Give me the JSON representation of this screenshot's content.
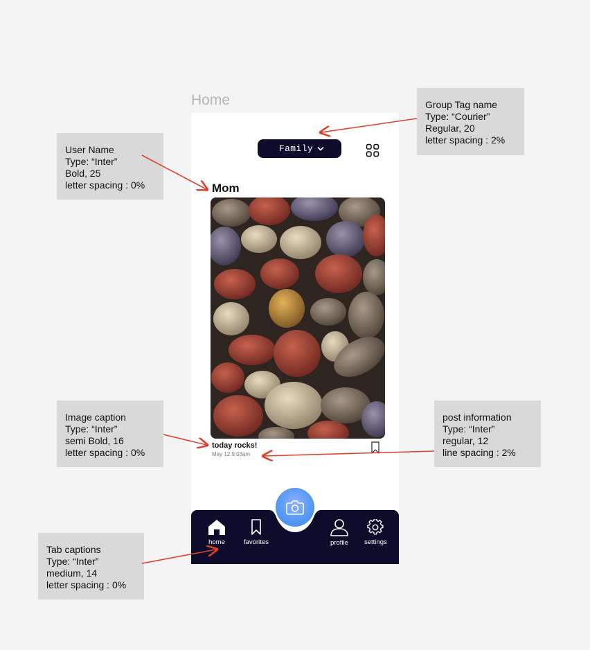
{
  "frame_title": "Home",
  "app": {
    "group_tag": "Family",
    "user_name": "Mom",
    "post": {
      "caption": "today rocks!",
      "info": "May 12 9:03am"
    },
    "tabs": [
      {
        "label": "home",
        "icon": "home-icon"
      },
      {
        "label": "favorites",
        "icon": "bookmark-icon"
      },
      {
        "label": "profile",
        "icon": "person-icon"
      },
      {
        "label": "settings",
        "icon": "gear-icon"
      }
    ],
    "colors": {
      "nav_bg": "#0d0d2b",
      "camera_button": "#5b9bf5",
      "annotation_arrow": "#e0402b"
    }
  },
  "annotations": {
    "group_tag": "Group Tag name\nType: “Courier”\nRegular, 20\nletter spacing : 2%",
    "user_name": "User Name\nType: “Inter”\nBold, 25\nletter spacing : 0%",
    "image_caption": "Image caption\nType: “Inter”\nsemi Bold, 16\nletter spacing : 0%",
    "post_info": "post information\nType: “Inter”\nregular, 12\nline spacing : 2%",
    "tab_captions": "Tab captions\nType: “Inter”\nmedium, 14\nletter spacing : 0%"
  }
}
